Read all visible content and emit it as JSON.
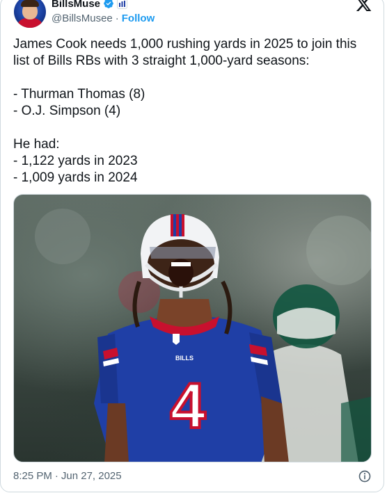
{
  "author": {
    "display_name": "BillsMuse",
    "handle": "@BillsMusee",
    "separator": "·",
    "follow_label": "Follow",
    "verified_color": "#1d9bf0"
  },
  "tweet": {
    "text": "James Cook needs 1,000 rushing yards in 2025 to join this list of Bills RBs with 3 straight 1,000-yard seasons:\n\n- Thurman Thomas (8)\n- O.J. Simpson (4)\n\nHe had:\n- 1,122 yards in 2023\n- 1,009 yards in 2024"
  },
  "media": {
    "jersey_number": "4",
    "jersey_text": "BILLS",
    "colors": {
      "bills_blue": "#1f3fa6",
      "bills_red": "#c8102e",
      "jets_green": "#125740"
    }
  },
  "meta": {
    "time": "8:25 PM",
    "separator": "·",
    "date": "Jun 27, 2025"
  },
  "icons": {
    "platform": "x-logo-icon",
    "verified": "verified-badge-icon",
    "affiliation": "affiliate-badge-icon",
    "info": "info-icon"
  }
}
